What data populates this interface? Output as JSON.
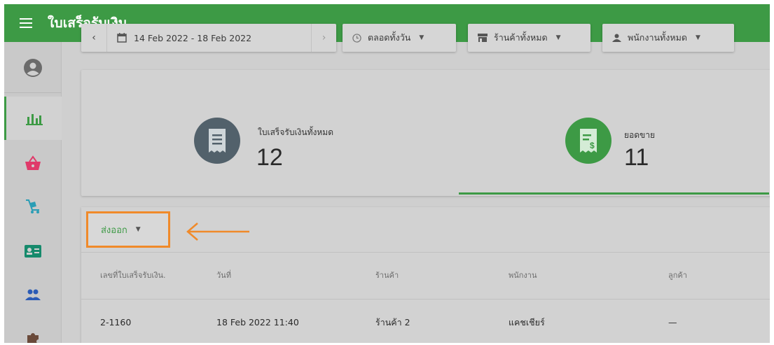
{
  "header": {
    "title": "ใบเสร็จรับเงิน"
  },
  "filters": {
    "date_range": "14 Feb 2022 - 18 Feb 2022",
    "prev_symbol": "‹",
    "next_symbol": "›",
    "time": "ตลอดทั้งวัน",
    "store": "ร้านค้าทั้งหมด",
    "staff": "พนักงานทั้งหมด"
  },
  "summary": {
    "receipts_label": "ใบเสร็จรับเงินทั้งหมด",
    "receipts_value": "12",
    "sales_label": "ยอดขาย",
    "sales_value": "11"
  },
  "export": {
    "label": "ส่งออก"
  },
  "table": {
    "columns": [
      "เลขที่ใบเสร็จรับเงิน.",
      "วันที่",
      "ร้านค้า",
      "พนักงาน",
      "ลูกค้า"
    ],
    "rows": [
      [
        "2-1160",
        "18 Feb 2022 11:40",
        "ร้านค้า 2",
        "แคชเชียร์",
        "—"
      ]
    ]
  },
  "colors": {
    "brand": "#3d9a45",
    "highlight": "#f08a2a",
    "receipt_icon_bg": "#52616b"
  },
  "icons": [
    "menu-icon",
    "account-icon",
    "chart-icon",
    "basket-icon",
    "cart-icon",
    "id-card-icon",
    "people-icon",
    "puzzle-icon",
    "calendar-icon",
    "clock-icon",
    "store-icon",
    "person-icon",
    "receipt-icon",
    "receipt-dollar-icon",
    "arrow-left-icon"
  ]
}
